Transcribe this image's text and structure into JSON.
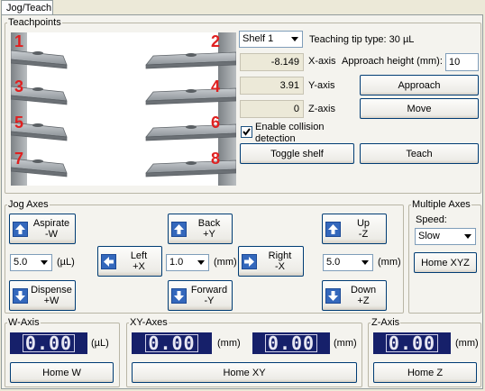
{
  "tab": {
    "label": "Jog/Teach"
  },
  "teachpoints": {
    "legend": "Teachpoints",
    "shelf_numbers": [
      "1",
      "2",
      "3",
      "4",
      "5",
      "6",
      "7",
      "8"
    ],
    "shelf_select": "Shelf 1",
    "tip_type": "Teaching tip type: 30 µL",
    "x_value": "-8.149",
    "x_label": "X-axis",
    "y_value": "3.91",
    "y_label": "Y-axis",
    "z_value": "0",
    "z_label": "Z-axis",
    "approach_height_label": "Approach height (mm):",
    "approach_height_value": "10",
    "approach_button": "Approach",
    "move_button": "Move",
    "collision_label": "Enable collision\ndetection",
    "toggle_shelf_button": "Toggle shelf",
    "teach_button": "Teach"
  },
  "jog": {
    "legend": "Jog Axes",
    "aspirate": "Aspirate\n-W",
    "dispense": "Dispense\n+W",
    "w_step": "5.0",
    "w_unit": "(µL)",
    "back": "Back\n+Y",
    "forward": "Forward\n-Y",
    "left": "Left\n+X",
    "right": "Right\n-X",
    "xy_step": "1.0",
    "xy_unit": "(mm)",
    "up": "Up\n-Z",
    "down": "Down\n+Z",
    "z_step": "5.0",
    "z_unit": "(mm)"
  },
  "multi": {
    "legend": "Multiple Axes",
    "speed_label": "Speed:",
    "speed_value": "Slow",
    "home_xyz": "Home XYZ"
  },
  "w_axis": {
    "legend": "W-Axis",
    "readout": "0.00",
    "unit": "(µL)",
    "home": "Home W"
  },
  "xy_axes": {
    "legend": "XY-Axes",
    "readout_x": "0.00",
    "readout_y": "0.00",
    "unit": "(mm)",
    "home": "Home XY"
  },
  "z_axis": {
    "legend": "Z-Axis",
    "readout": "0.00",
    "unit": "(mm)",
    "home": "Home Z"
  },
  "colors": {
    "accent": "#3468bc",
    "readout_bg": "#16206a",
    "shelf_number": "#e02020"
  }
}
